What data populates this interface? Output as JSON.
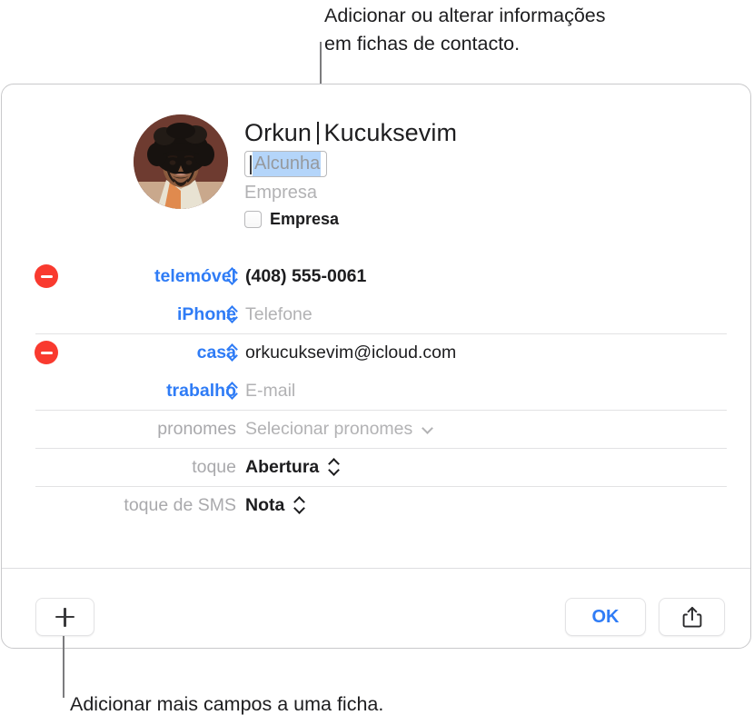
{
  "callouts": {
    "top": "Adicionar ou alterar informações\nem fichas de contacto.",
    "bottom": "Adicionar mais campos a uma ficha."
  },
  "contact": {
    "first_name": "Orkun",
    "last_name": "Kucuksevim",
    "nickname_placeholder": "Alcunha",
    "company_placeholder": "Empresa",
    "company_checkbox_label": "Empresa",
    "avatar_alt": "contact-photo"
  },
  "fields": [
    {
      "label": "telemóvel",
      "label_style": "blue",
      "value": "(408) 555-0061",
      "value_style": "filled-bold",
      "has_remove": true,
      "control": "stepper-blue",
      "separator": false
    },
    {
      "label": "iPhone",
      "label_style": "blue",
      "value": "Telefone",
      "value_style": "placeholder",
      "has_remove": false,
      "control": "stepper-blue",
      "separator": false
    },
    {
      "label": "casa",
      "label_style": "blue",
      "value": "orkucuksevim@icloud.com",
      "value_style": "filled",
      "has_remove": true,
      "control": "stepper-blue",
      "separator": true
    },
    {
      "label": "trabalho",
      "label_style": "blue",
      "value": "E-mail",
      "value_style": "placeholder",
      "has_remove": false,
      "control": "stepper-blue",
      "separator": false
    },
    {
      "label": "pronomes",
      "label_style": "gray",
      "value": "Selecionar pronomes",
      "value_style": "placeholder",
      "has_remove": false,
      "control": "chevron-down",
      "separator": true
    },
    {
      "label": "toque",
      "label_style": "gray",
      "value": "Abertura",
      "value_style": "filled-bold",
      "has_remove": false,
      "control": "stepper-dark",
      "separator": true
    },
    {
      "label": "toque de SMS",
      "label_style": "gray",
      "value": "Nota",
      "value_style": "filled-bold",
      "has_remove": false,
      "control": "stepper-dark",
      "separator": true
    }
  ],
  "toolbar": {
    "add_field_icon": "plus-icon",
    "ok_label": "OK",
    "share_icon": "share-icon"
  },
  "colors": {
    "accent_blue": "#2f7cf6",
    "remove_red": "#f93a2f",
    "selection_blue": "#b4d5fa",
    "placeholder_gray": "#b2b2b4",
    "panel_border": "#c9c9cb"
  }
}
